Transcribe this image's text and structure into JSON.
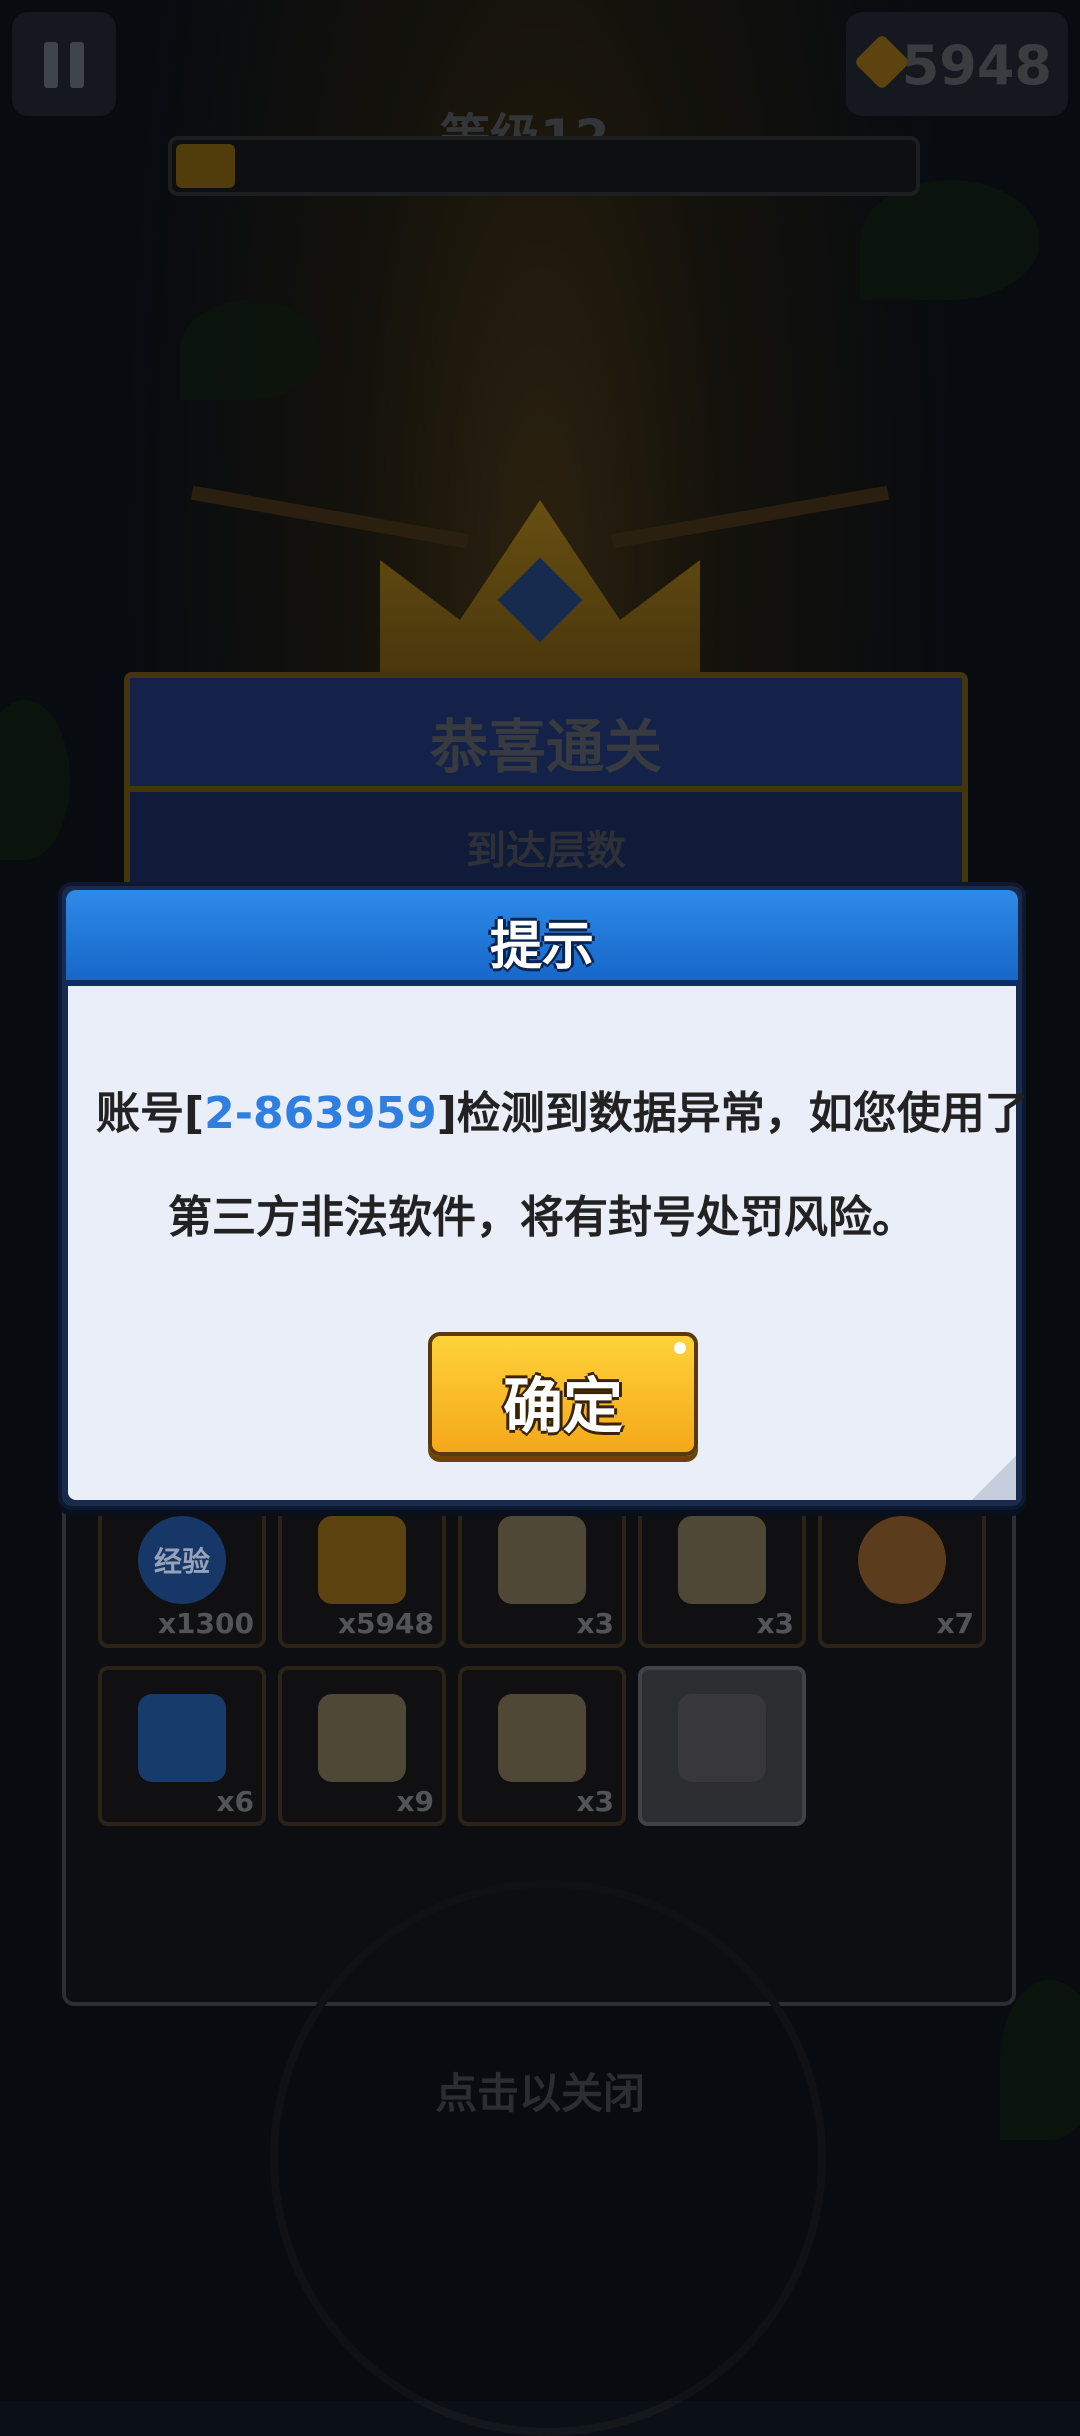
{
  "hud": {
    "pause_icon": "pause-icon",
    "gold_icon": "gold-diamond-icon",
    "gold_value": "5948",
    "level_label": "等级12",
    "xp_progress": 0.08
  },
  "victory": {
    "title": "恭喜通关",
    "subtitle": "到达层数",
    "close_hint": "点击以关闭"
  },
  "rewards": [
    {
      "icon": "exp-badge-icon",
      "label": "经验",
      "qty": "x1300"
    },
    {
      "icon": "gold-diamond-icon",
      "label": "",
      "qty": "x5948"
    },
    {
      "icon": "scroll-paw-icon",
      "label": "",
      "qty": "x3"
    },
    {
      "icon": "scroll-bow-icon",
      "label": "",
      "qty": "x3"
    },
    {
      "icon": "cookie-icon",
      "label": "",
      "qty": "x7"
    },
    {
      "icon": "blue-gem-icon",
      "label": "",
      "qty": "x6"
    },
    {
      "icon": "scroll-belt-icon",
      "label": "",
      "qty": "x9"
    },
    {
      "icon": "scroll-ring-icon",
      "label": "",
      "qty": "x3"
    },
    {
      "icon": "sword-icon",
      "label": "",
      "qty": ""
    }
  ],
  "dialog": {
    "title": "提示",
    "message_prefix": "账号[",
    "account_id": "2-863959",
    "message_mid": "]检测到数据异常，如您使用了",
    "message_line2": "第三方非法软件，将有封号处罚风险。",
    "confirm_label": "确定"
  },
  "colors": {
    "dialog_header": "#1667c8",
    "dialog_body": "#e9eef8",
    "account_id": "#2f7fe0",
    "confirm_button": "#f4a81a"
  }
}
